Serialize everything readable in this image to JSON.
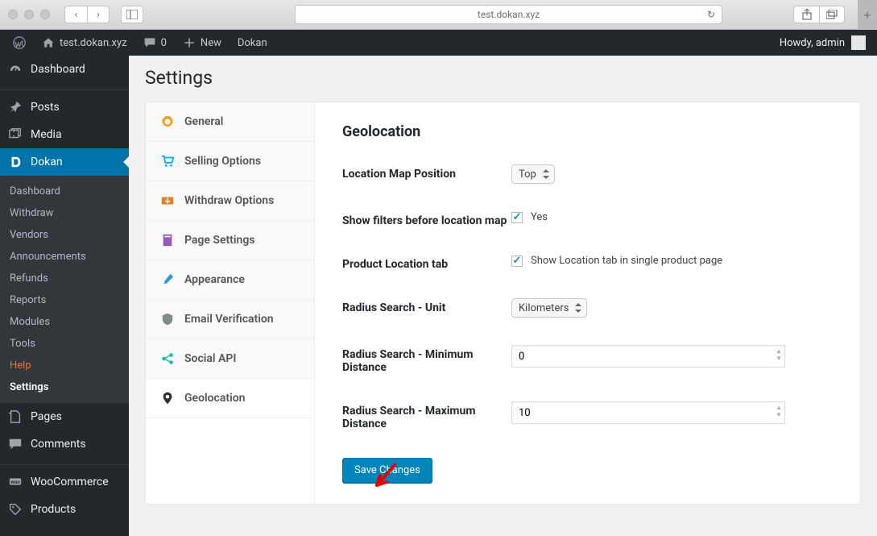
{
  "browser": {
    "url": "test.dokan.xyz"
  },
  "adminbar": {
    "site": "test.dokan.xyz",
    "comments": "0",
    "new": "New",
    "dokan": "Dokan",
    "howdy": "Howdy, admin"
  },
  "sidebar": {
    "dashboard": "Dashboard",
    "posts": "Posts",
    "media": "Media",
    "dokan": "Dokan",
    "sub": {
      "dashboard": "Dashboard",
      "withdraw": "Withdraw",
      "vendors": "Vendors",
      "announcements": "Announcements",
      "refunds": "Refunds",
      "reports": "Reports",
      "modules": "Modules",
      "tools": "Tools",
      "help": "Help",
      "settings": "Settings"
    },
    "pages": "Pages",
    "comments": "Comments",
    "woocommerce": "WooCommerce",
    "products": "Products"
  },
  "page": {
    "title": "Settings"
  },
  "tabs": {
    "general": "General",
    "selling": "Selling Options",
    "withdraw": "Withdraw Options",
    "page": "Page Settings",
    "appearance": "Appearance",
    "email": "Email Verification",
    "social": "Social API",
    "geo": "Geolocation"
  },
  "form": {
    "section": "Geolocation",
    "map_position": {
      "label": "Location Map Position",
      "value": "Top"
    },
    "show_filters": {
      "label": "Show filters before location map",
      "option": "Yes"
    },
    "product_tab": {
      "label": "Product Location tab",
      "option": "Show Location tab in single product page"
    },
    "radius_unit": {
      "label": "Radius Search - Unit",
      "value": "Kilometers"
    },
    "radius_min": {
      "label": "Radius Search - Minimum Distance",
      "value": "0"
    },
    "radius_max": {
      "label": "Radius Search - Maximum Distance",
      "value": "10"
    },
    "save": "Save Changes"
  }
}
